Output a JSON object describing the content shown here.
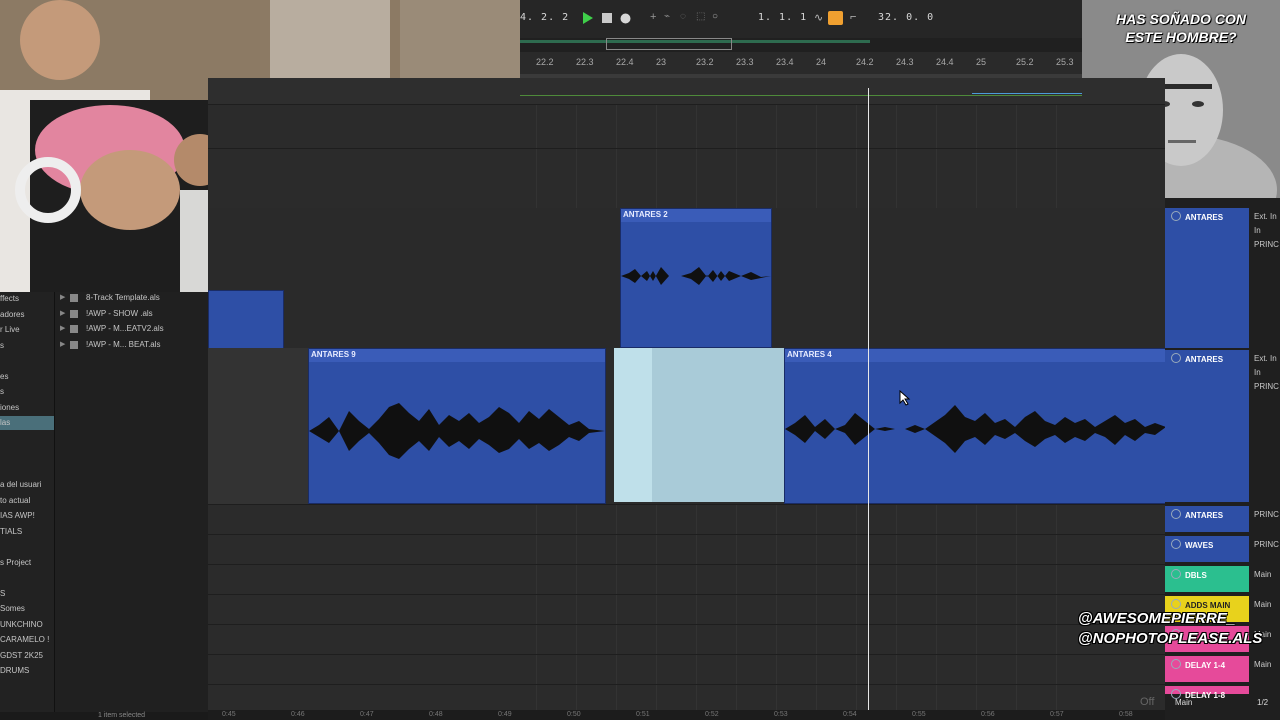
{
  "transport": {
    "position_left": "4. 2. 2",
    "position_main": "1. 1. 1",
    "loop_length": "32. 0. 0"
  },
  "ruler": {
    "ticks": [
      "22.2",
      "22.3",
      "22.4",
      "23",
      "23.2",
      "23.3",
      "23.4",
      "24",
      "24.2",
      "24.3",
      "24.4",
      "25",
      "25.2",
      "25.3"
    ]
  },
  "clips": {
    "antares2": "ANTARES 2",
    "antares9": "ANTARES 9",
    "antares4": "ANTARES 4"
  },
  "mixer": {
    "tracks": [
      {
        "name": "ANTARES",
        "color": "#2e4fa6",
        "io1": "Ext. In",
        "io2": "In",
        "io3": "PRINC"
      },
      {
        "name": "ANTARES",
        "color": "#2e4fa6",
        "io1": "Ext. In",
        "io2": "In",
        "io3": "PRINC"
      },
      {
        "name": "ANTARES",
        "color": "#2e4fa6",
        "io1": "PRINC"
      },
      {
        "name": "WAVES",
        "color": "#2e4fa6",
        "io1": "PRINC"
      },
      {
        "name": "DBLS",
        "color": "#2bbf8f",
        "io1": "Main"
      },
      {
        "name": "ADDS MAIN",
        "color": "#e8d21c",
        "io1": "Main"
      },
      {
        "name": "",
        "color": "#e64a9a",
        "io1": "Main"
      },
      {
        "name": "DELAY 1-4",
        "color": "#e64a9a",
        "io1": "Main"
      },
      {
        "name": "DELAY 1-8",
        "color": "#e64a9a",
        "io1": ""
      }
    ],
    "master": "Main",
    "master_count": "1/2",
    "off": "Off"
  },
  "browser": {
    "left_items": [
      "ffects",
      "adores",
      "r Live",
      "s",
      "",
      "es",
      "s",
      "iones",
      "las",
      "",
      "",
      "",
      "a del usuari",
      "to actual",
      "IAS AWP!",
      "TIALS",
      "",
      "s Project",
      "",
      "S",
      "Somes",
      "UNKCHINO",
      "CARAMELO !",
      "GDST 2K25",
      "DRUMS"
    ],
    "files": [
      "8-Track Template.als",
      "!AWP - SHOW .als",
      "!AWP - M...EATV2.als",
      "!AWP - M... BEAT.als"
    ],
    "status": "1 item selected"
  },
  "timebar": {
    "labels": [
      "0:45",
      "0:46",
      "0:47",
      "0:48",
      "0:49",
      "0:50",
      "0:51",
      "0:52",
      "0:53",
      "0:54",
      "0:55",
      "0:56",
      "0:57",
      "0:58"
    ]
  },
  "overlay": {
    "cam_title_line1": "HAS SOÑADO CON",
    "cam_title_line2": "ESTE HOMBRE?",
    "handle1": "@AWESOMEPIERRE_",
    "handle2": "@NOPHOTOPLEASE.ALS"
  },
  "colors": {
    "clip_blue": "#2e4fa6",
    "selection": "#a9cbd8",
    "play_green": "#3fcf4a",
    "loop_orange": "#f0a030"
  }
}
